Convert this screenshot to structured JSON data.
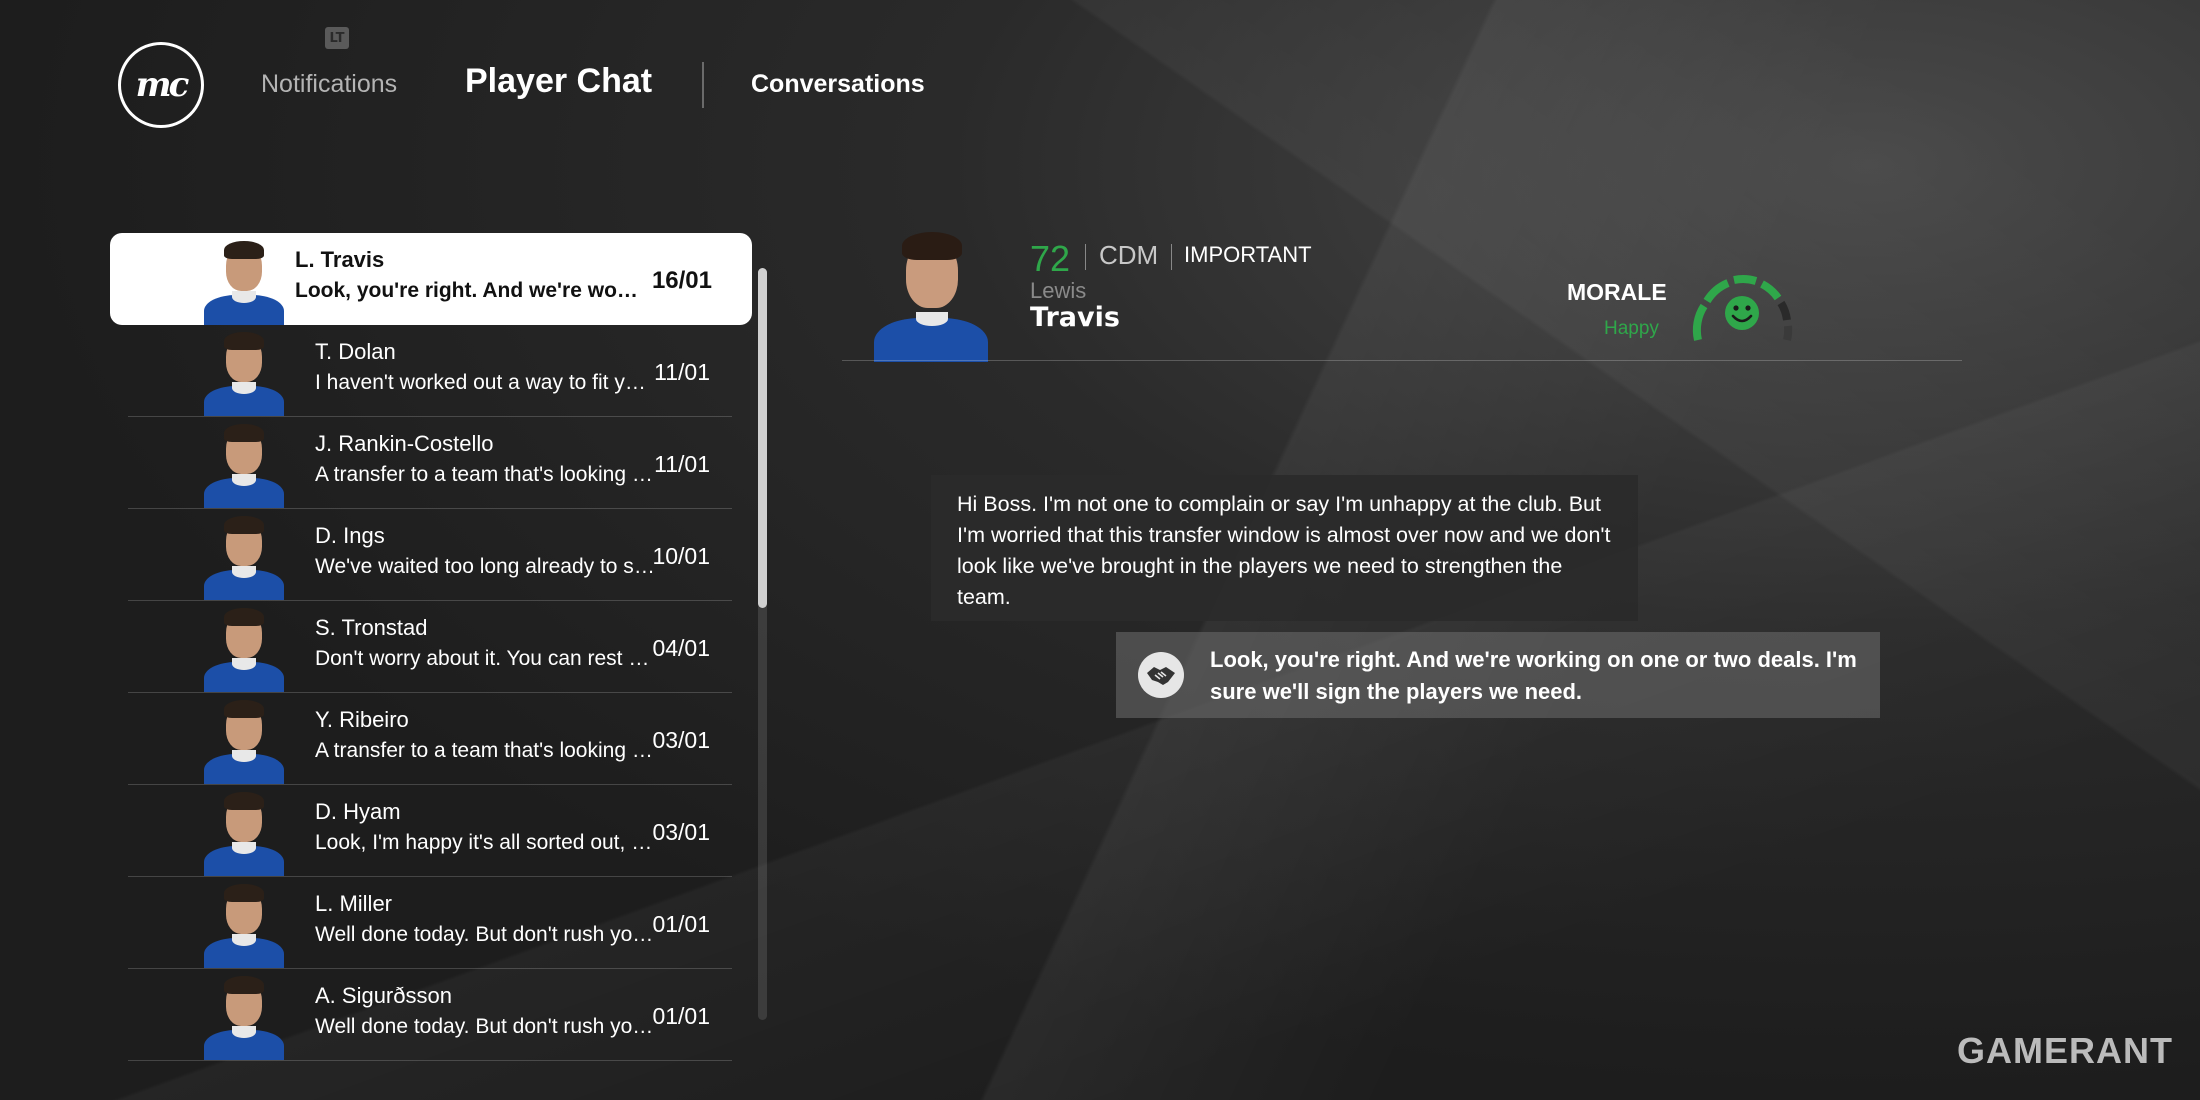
{
  "header": {
    "logo": "mc",
    "badge": "LT",
    "tabs": [
      "Notifications",
      "Player Chat",
      "Conversations"
    ]
  },
  "conversations": [
    {
      "name": "L. Travis",
      "preview": "Look, you're right. And we're working on one or two deals.",
      "date": "16/01",
      "active": true
    },
    {
      "name": "T. Dolan",
      "preview": "I haven't worked out a way to fit you in yet.",
      "date": "11/01"
    },
    {
      "name": "J. Rankin-Costello",
      "preview": "A transfer to a team that's looking for a player like you.",
      "date": "11/01"
    },
    {
      "name": "D. Ings",
      "preview": "We've waited too long already to sort this out.",
      "date": "10/01"
    },
    {
      "name": "S. Tronstad",
      "preview": "Don't worry about it. You can rest easy.",
      "date": "04/01"
    },
    {
      "name": "Y. Ribeiro",
      "preview": "A transfer to a team that's looking for a player like you.",
      "date": "03/01"
    },
    {
      "name": "D. Hyam",
      "preview": "Look, I'm happy it's all sorted out, now focus.",
      "date": "03/01"
    },
    {
      "name": "L. Miller",
      "preview": "Well done today. But don't rush your recovery.",
      "date": "01/01"
    },
    {
      "name": "A. Sigurðsson",
      "preview": "Well done today. But don't rush your recovery.",
      "date": "01/01"
    }
  ],
  "player": {
    "rating": "72",
    "position": "CDM",
    "importance": "IMPORTANT",
    "first_name": "Lewis",
    "last_name": "Travis",
    "morale_label": "MORALE",
    "morale_status": "Happy"
  },
  "messages": {
    "player": "Hi Boss. I'm not one to complain or say I'm unhappy at the club. But I'm worried that this transfer window is almost over now and we don't look like we've brought in the players we need to strengthen the team.",
    "reply": "Look, you're right. And we're working on one or two deals. I'm sure we'll sign the players we need."
  },
  "watermark": "GAMERANT",
  "colors": {
    "accent_green": "#2fa74a",
    "kit_blue": "#1c4fa8"
  }
}
